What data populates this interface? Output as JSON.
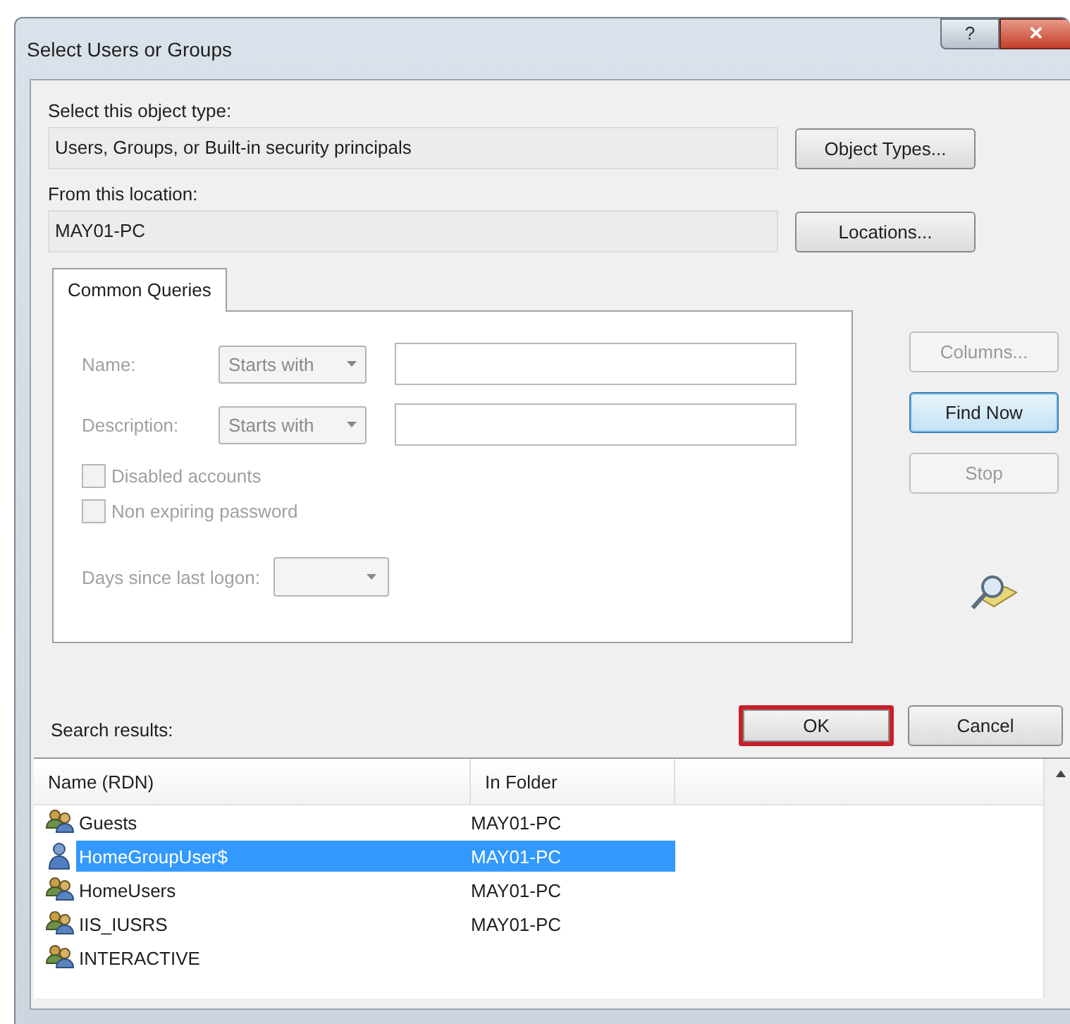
{
  "window": {
    "title": "Select Users or Groups",
    "help_button": "?",
    "close_button": "✕"
  },
  "object_type": {
    "label": "Select this object type:",
    "value": "Users, Groups, or Built-in security principals",
    "button": "Object Types..."
  },
  "location": {
    "label": "From this location:",
    "value": "MAY01-PC",
    "button": "Locations..."
  },
  "tabs": [
    {
      "label": "Common Queries",
      "selected": true
    }
  ],
  "query": {
    "disabled": true,
    "rows": [
      {
        "label": "Name:",
        "operator": "Starts with"
      },
      {
        "label": "Description:",
        "operator": "Starts with"
      }
    ],
    "checkboxes": [
      {
        "label": "Disabled accounts",
        "checked": false
      },
      {
        "label": "Non expiring password",
        "checked": false
      }
    ],
    "days_label": "Days since last logon:"
  },
  "side_buttons": [
    {
      "label": "Columns...",
      "disabled": true,
      "focused": false
    },
    {
      "label": "Find Now",
      "disabled": false,
      "focused": true
    },
    {
      "label": "Stop",
      "disabled": true,
      "focused": false
    }
  ],
  "dialog_buttons": [
    {
      "label": "OK",
      "highlighted": true
    },
    {
      "label": "Cancel",
      "highlighted": false
    }
  ],
  "results": {
    "label": "Search results:",
    "columns": [
      "Name (RDN)",
      "In Folder"
    ],
    "rows": [
      {
        "kind": "group",
        "name": "Guests",
        "folder": "MAY01-PC",
        "selected": false
      },
      {
        "kind": "user",
        "name": "HomeGroupUser$",
        "folder": "MAY01-PC",
        "selected": true
      },
      {
        "kind": "group",
        "name": "HomeUsers",
        "folder": "MAY01-PC",
        "selected": false
      },
      {
        "kind": "group",
        "name": "IIS_IUSRS",
        "folder": "MAY01-PC",
        "selected": false
      },
      {
        "kind": "group",
        "name": "INTERACTIVE",
        "selected": false
      }
    ]
  }
}
